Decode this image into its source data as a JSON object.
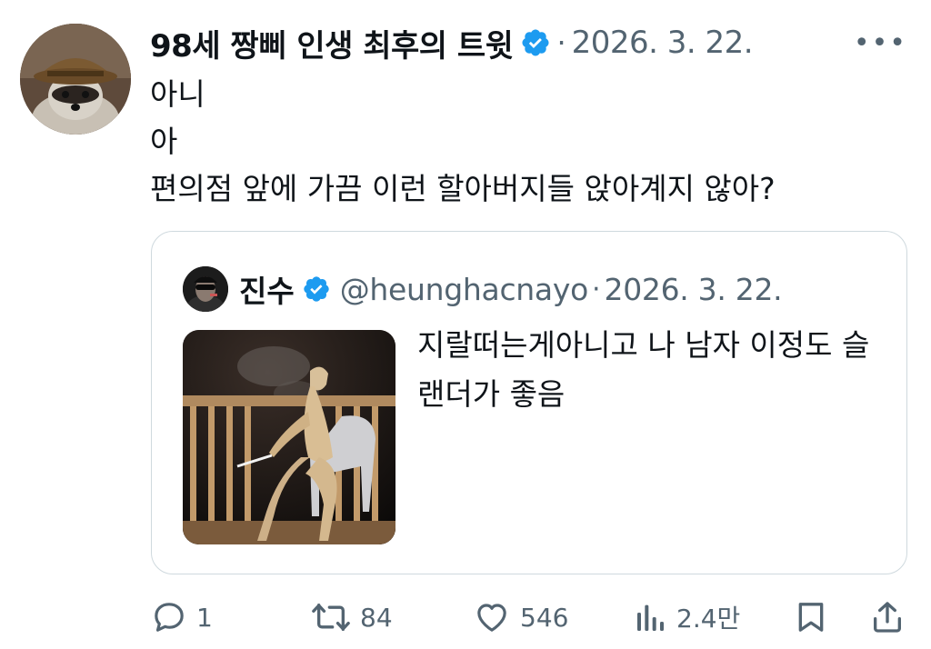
{
  "author": {
    "name": "98세 짱삐 인생 최후의 트윗",
    "date": "2026. 3. 22."
  },
  "tweet_lines": [
    "아니",
    "아",
    "편의점 앞에 가끔 이런 할아버지들 앉아계지 않아?"
  ],
  "quoted": {
    "name": "진수",
    "handle": "@heunghacnayo",
    "date": "2026. 3. 22.",
    "text": "지랄떠는게아니고 나 남자 이정도 슬랜더가 좋음"
  },
  "actions": {
    "replies": "1",
    "retweets": "84",
    "likes": "546",
    "views": "2.4만"
  },
  "colors": {
    "verified": "#1d9bf0",
    "secondary_text": "#536471",
    "border": "#cfd9de"
  }
}
